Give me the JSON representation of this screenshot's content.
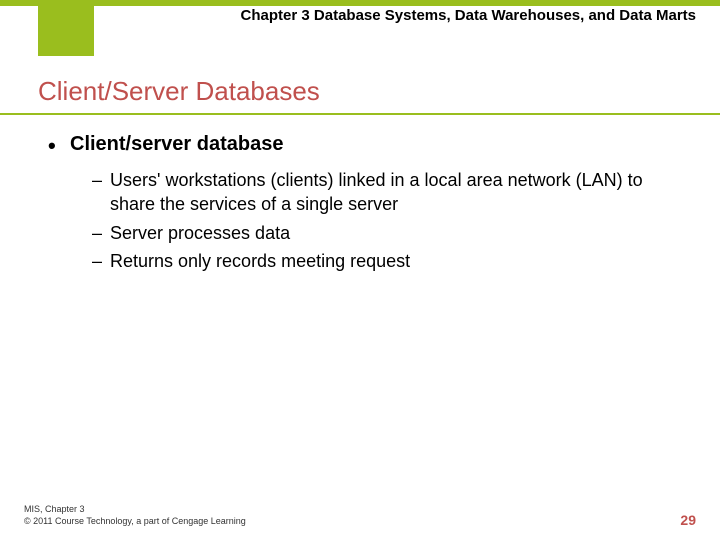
{
  "header": {
    "chapter_title": "Chapter 3 Database Systems, Data Warehouses, and Data Marts"
  },
  "section": {
    "title": "Client/Server Databases"
  },
  "content": {
    "main_bullet": "Client/server database",
    "sub_items": [
      "Users' workstations (clients) linked in a local area network (LAN) to share the services of a single server",
      "Server processes data",
      "Returns only records meeting request"
    ]
  },
  "footer": {
    "line1": "MIS, Chapter 3",
    "line2": "© 2011 Course Technology, a part of Cengage Learning",
    "page_number": "29"
  }
}
